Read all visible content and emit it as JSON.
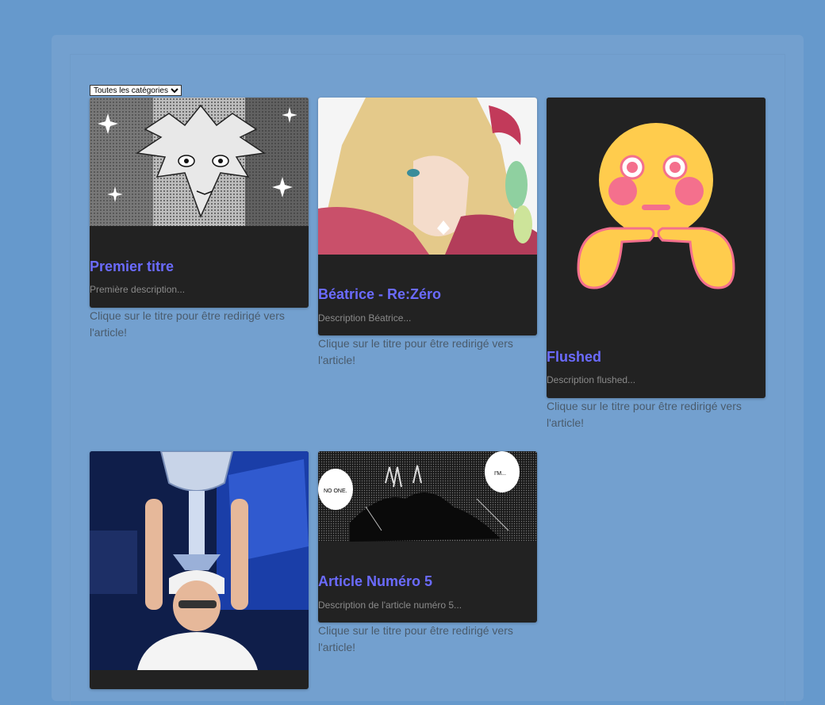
{
  "filter": {
    "selected": "Toutes les catégories"
  },
  "hint_text": "Clique sur le titre pour être redirigé vers l'article!",
  "articles": [
    {
      "title": "Premier titre",
      "description": "Première description..."
    },
    {
      "title": "Béatrice - Re:Zéro",
      "description": "Description Béatrice..."
    },
    {
      "title": "Flushed",
      "description": "Description flushed..."
    },
    {
      "title": "",
      "description": ""
    },
    {
      "title": "Article Numéro 5",
      "description": "Description de l'article numéro 5..."
    }
  ],
  "images": {
    "manga_panel_5": {
      "bubble_left": "NO ONE.",
      "bubble_right": "I'M..."
    }
  },
  "colors": {
    "page_bg": "#6699cc",
    "panel_bg": "#73a0cf",
    "card_bg": "#222222",
    "title_link": "#6b6bff"
  }
}
